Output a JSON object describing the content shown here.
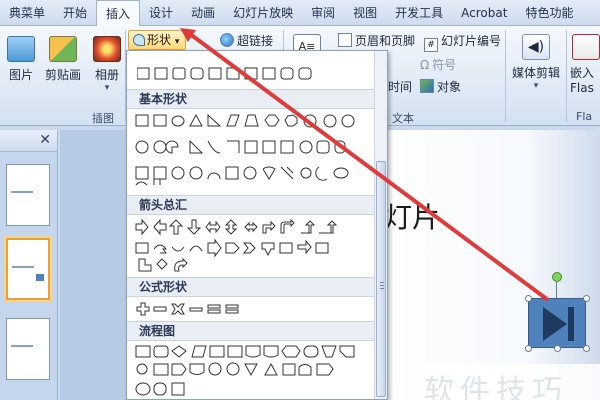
{
  "tabs": [
    "典菜单",
    "开始",
    "插入",
    "设计",
    "动画",
    "幻灯片放映",
    "审阅",
    "视图",
    "开发工具",
    "Acrobat",
    "特色功能"
  ],
  "active_tab": "插入",
  "ribbon": {
    "picture": "图片",
    "clipart": "剪贴画",
    "album": "相册",
    "illustrations_group": "插图",
    "shapes": "形状",
    "hyperlink": "超链接",
    "header_footer": "页眉和页脚",
    "slide_number": "幻灯片编号",
    "datetime": "时间",
    "symbol": "符号",
    "object": "对象",
    "text_group": "文本",
    "media": "媒体剪辑",
    "embed": "嵌入",
    "flash": "Flas",
    "flash_group": "Fla"
  },
  "gallery": {
    "sections": [
      "基本形状",
      "箭头总汇",
      "公式形状",
      "流程图"
    ]
  },
  "slide": {
    "text": "灯片"
  },
  "watermark": "软件技巧",
  "colors": {
    "accent": "#e03a3a",
    "shape_fill": "#4f81bd"
  }
}
